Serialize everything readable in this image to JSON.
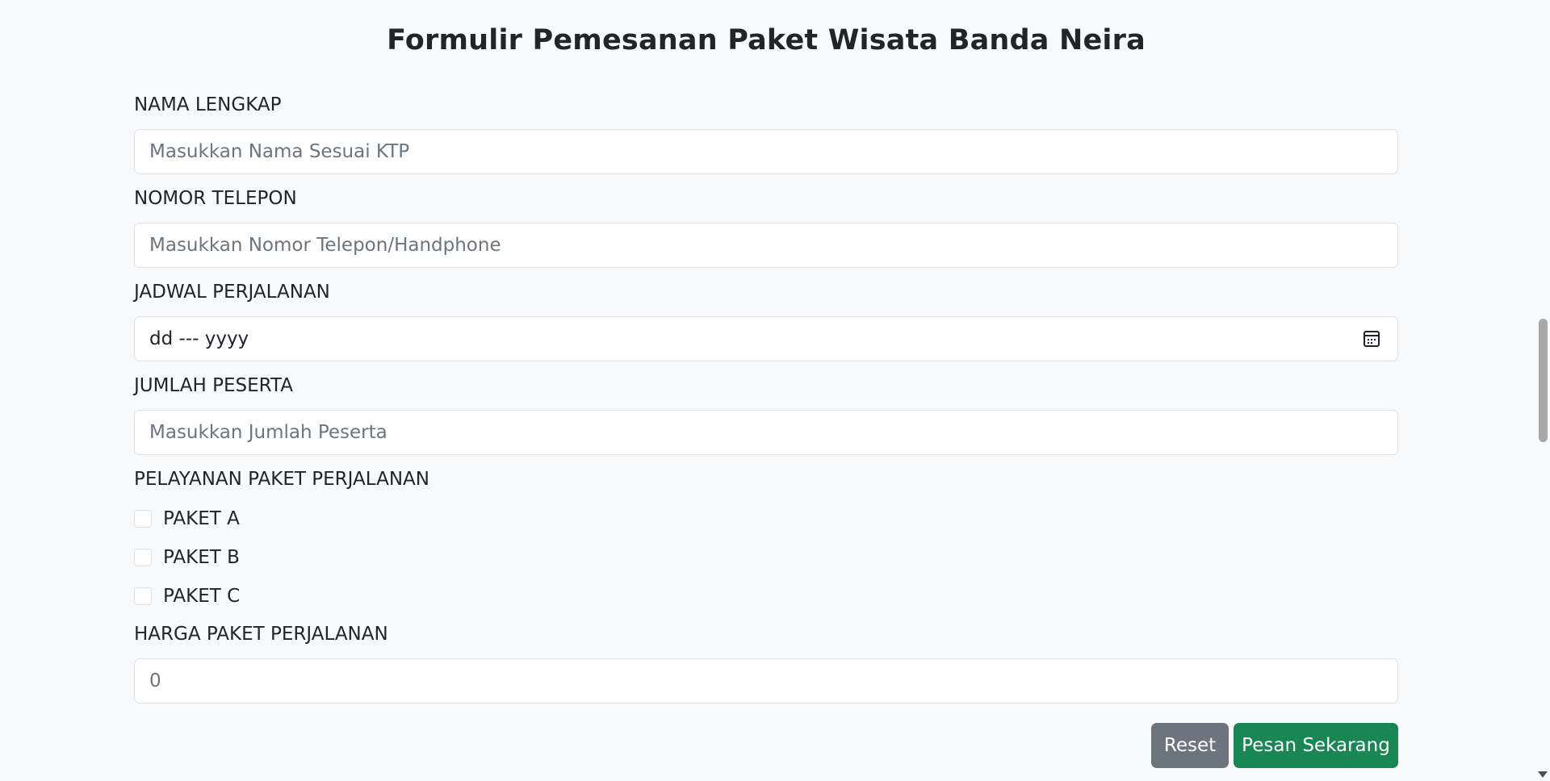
{
  "form": {
    "title": "Formulir Pemesanan Paket Wisata Banda Neira",
    "nama": {
      "label": "NAMA LENGKAP",
      "placeholder": "Masukkan Nama Sesuai KTP"
    },
    "telepon": {
      "label": "NOMOR TELEPON",
      "placeholder": "Masukkan Nomor Telepon/Handphone"
    },
    "jadwal": {
      "label": "JADWAL PERJALANAN",
      "value": "dd --- yyyy",
      "icon": "calendar-icon"
    },
    "peserta": {
      "label": "JUMLAH PESERTA",
      "placeholder": "Masukkan Jumlah Peserta"
    },
    "pelayanan": {
      "label": "PELAYANAN PAKET PERJALANAN",
      "options": [
        {
          "label": "PAKET A",
          "checked": false
        },
        {
          "label": "PAKET B",
          "checked": false
        },
        {
          "label": "PAKET C",
          "checked": false
        }
      ]
    },
    "harga": {
      "label": "HARGA PAKET PERJALANAN",
      "value": "0"
    },
    "buttons": {
      "reset": "Reset",
      "submit": "Pesan Sekarang"
    }
  },
  "colors": {
    "background": "#f8f9fa",
    "reset_button": "#6c757d",
    "submit_button": "#198754",
    "border": "#dee2e6"
  }
}
